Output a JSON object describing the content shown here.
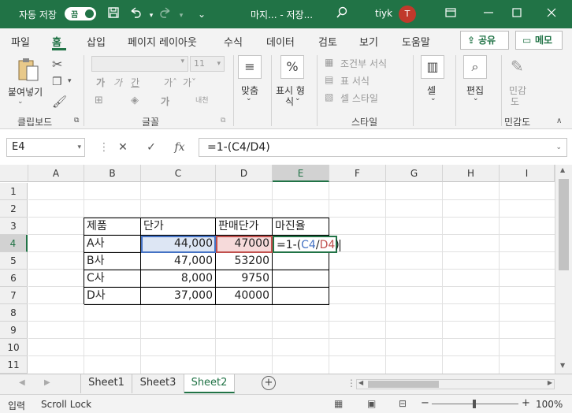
{
  "titlebar": {
    "autosave_label": "자동 저장",
    "autosave_toggle": "끔",
    "save_icon": "save-icon",
    "undo_icon": "undo-icon",
    "redo_icon": "redo-icon",
    "document_title": "마지... - 저장...",
    "search_icon": "search-icon",
    "username": "tiyk",
    "avatar_initial": "T",
    "brand_color": "#217346"
  },
  "menu_tabs": [
    "파일",
    "홈",
    "삽입",
    "페이지 레이아웃",
    "수식",
    "데이터",
    "검토",
    "보기",
    "도움말"
  ],
  "active_tab": "홈",
  "share_label": "공유",
  "memo_label": "메모",
  "ribbon": {
    "paste_label": "붙여넣기",
    "clipboard_group": "클립보드",
    "font_size_value": "11",
    "font_group": "글꼴",
    "alignment_label": "맞춤",
    "number_label_1": "표시 형",
    "number_label_2": "식",
    "number_icon": "%",
    "conditional_label": "조건부 서식",
    "table_format_label": "표 서식",
    "cell_style_label": "셀 스타일",
    "styles_group": "스타일",
    "cells_label": "셀",
    "editing_label": "편집",
    "sensitivity_label_1": "민감",
    "sensitivity_label_2": "도",
    "sensitivity_group": "민감도",
    "font_buttons": [
      "가",
      "가",
      "간",
      "가ˆ",
      "가ˇ"
    ],
    "font_buttons_2": [
      "가",
      "내천"
    ]
  },
  "formula_bar": {
    "name_box": "E4",
    "cancel_icon": "✕",
    "enter_icon": "✓",
    "fx_label": "fx",
    "formula": "=1-(C4/D4)"
  },
  "grid": {
    "columns": [
      "A",
      "B",
      "C",
      "D",
      "E",
      "F",
      "G",
      "H",
      "I"
    ],
    "rows": [
      "1",
      "2",
      "3",
      "4",
      "5",
      "6",
      "7",
      "8",
      "9",
      "10",
      "11"
    ],
    "selected_column": "E",
    "selected_row": "4",
    "table": {
      "headers": [
        "제품",
        "단가",
        "판매단가",
        "마진율"
      ],
      "rows": [
        {
          "product": "A사",
          "unit_price": "44,000",
          "sale_price": "47000",
          "margin": "=1-(C4/D4)"
        },
        {
          "product": "B사",
          "unit_price": "47,000",
          "sale_price": "53200",
          "margin": ""
        },
        {
          "product": "C사",
          "unit_price": "8,000",
          "sale_price": "9750",
          "margin": ""
        },
        {
          "product": "D사",
          "unit_price": "37,000",
          "sale_price": "40000",
          "margin": ""
        }
      ]
    },
    "edit_formula_parts": [
      "=1-(",
      "C4",
      "/",
      "D4",
      ")"
    ],
    "ref_color_c4": "#4472c4",
    "ref_color_d4": "#c0504d"
  },
  "sheets": [
    "Sheet1",
    "Sheet3",
    "Sheet2"
  ],
  "active_sheet": "Sheet2",
  "add_sheet_icon": "+",
  "statusbar": {
    "mode": "입력",
    "scroll_lock": "Scroll Lock",
    "zoom": "100%",
    "zoom_minus": "−",
    "zoom_plus": "+"
  }
}
